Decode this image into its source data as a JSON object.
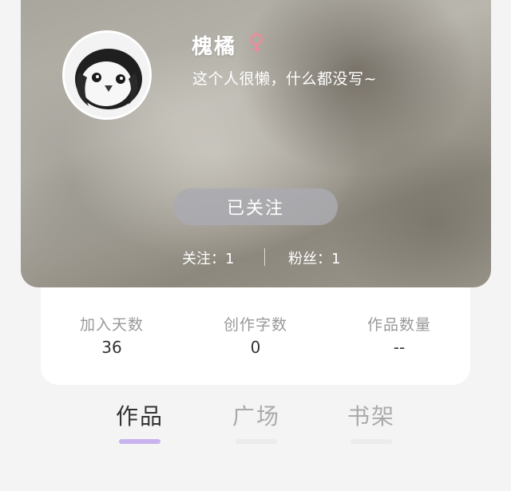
{
  "profile": {
    "username": "槐橘",
    "gender_symbol": "♀",
    "bio": "这个人很懒，什么都没写~",
    "follow_button": "已关注",
    "following_text": "关注：1",
    "fans_text": "粉丝：1"
  },
  "stats": [
    {
      "label": "加入天数",
      "value": "36"
    },
    {
      "label": "创作字数",
      "value": "0"
    },
    {
      "label": "作品数量",
      "value": "--"
    }
  ],
  "tabs": [
    {
      "label": "作品",
      "active": true
    },
    {
      "label": "广场",
      "active": false
    },
    {
      "label": "书架",
      "active": false
    }
  ],
  "colors": {
    "accent_indicator": "#c9b3ee",
    "gender": "#ef8a9a",
    "tab_active": "#333333",
    "tab_inactive": "#aaaaaa"
  },
  "icons": {
    "avatar": "penguin-avatar"
  }
}
